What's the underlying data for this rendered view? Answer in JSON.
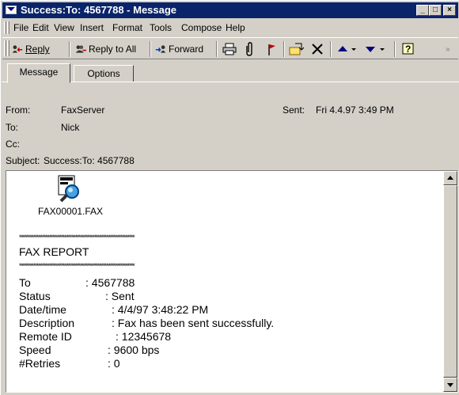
{
  "window": {
    "title": "Success:To: 4567788 - Message",
    "controls": [
      "_",
      "□",
      "×"
    ]
  },
  "menu": {
    "items": [
      "File",
      "Edit",
      "View",
      "Insert",
      "Format",
      "Tools",
      "Compose",
      "Help"
    ],
    "mnemonics": [
      "F",
      "E",
      "V",
      "I",
      "o",
      "T",
      "p",
      "H"
    ]
  },
  "toolbar": {
    "reply": "Reply",
    "reply_all": "Reply to All",
    "forward": "Forward",
    "icons": [
      "print-icon",
      "paperclip-icon",
      "flag-icon",
      "move-to-folder-icon",
      "delete-icon",
      "previous-item-icon",
      "next-item-icon",
      "help-icon"
    ]
  },
  "tabs": [
    "Message",
    "Options"
  ],
  "header": {
    "from_label": "From:",
    "from_value": "FaxServer",
    "sent_label": "Sent:",
    "sent_value": "Fri 4.4.97 3:49 PM",
    "to_label": "To:",
    "to_value": "Nick",
    "cc_label": "Cc:",
    "cc_value": "",
    "subject_label": "Subject:",
    "subject_value": "Success:To: 4567788"
  },
  "body": {
    "attachment_name": "FAX00001.FAX",
    "divider": "******************************************************************",
    "report_title": "FAX REPORT",
    "rows": [
      {
        "label": "To",
        "value": ": 4567788"
      },
      {
        "label": "Status",
        "value": ": Sent"
      },
      {
        "label": "Date/time",
        "value": ": 4/4/97  3:48:22 PM"
      },
      {
        "label": "Description",
        "value": ": Fax has been sent successfully."
      },
      {
        "label": "Remote ID",
        "value": ": 12345678"
      },
      {
        "label": "Speed",
        "value": ": 9600 bps"
      },
      {
        "label": "#Retries",
        "value": ": 0"
      }
    ]
  }
}
